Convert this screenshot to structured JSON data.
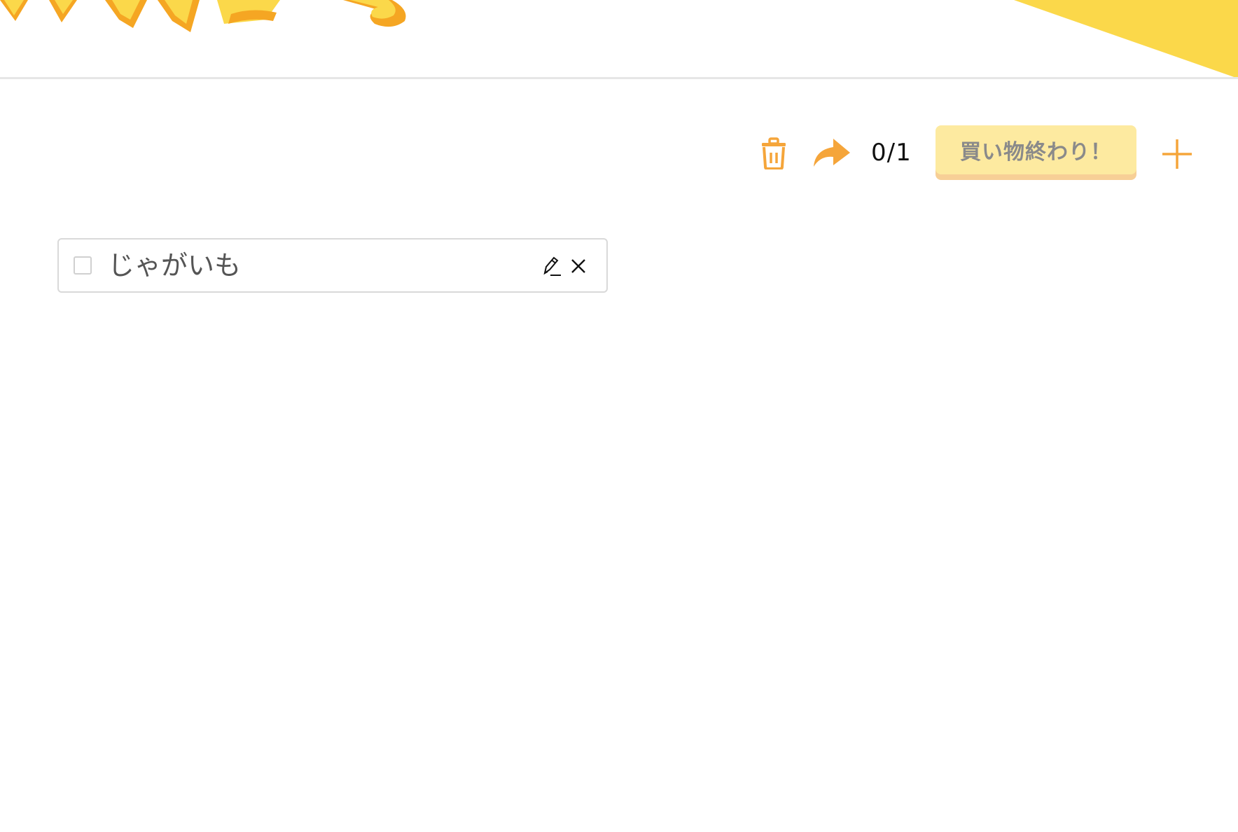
{
  "header": {
    "brand_color": "#f5a623",
    "accent_color": "#fbd84a",
    "logo_icon": "shopping-memo-logo-icon",
    "corner_icon": "yellow-corner-decoration-icon"
  },
  "toolbar": {
    "trash_icon": "trash-icon",
    "share_icon": "share-arrow-icon",
    "counter": "0/1",
    "finish_label": "買い物終わり！",
    "add_icon": "plus-icon"
  },
  "items": [
    {
      "label": "じゃがいも",
      "checked": false,
      "edit_icon": "pencil-icon",
      "delete_icon": "close-icon"
    }
  ],
  "colors": {
    "button_bg": "#fdeaa0",
    "button_shadow": "#f7cf96",
    "icon_orange": "#f5a53a"
  }
}
